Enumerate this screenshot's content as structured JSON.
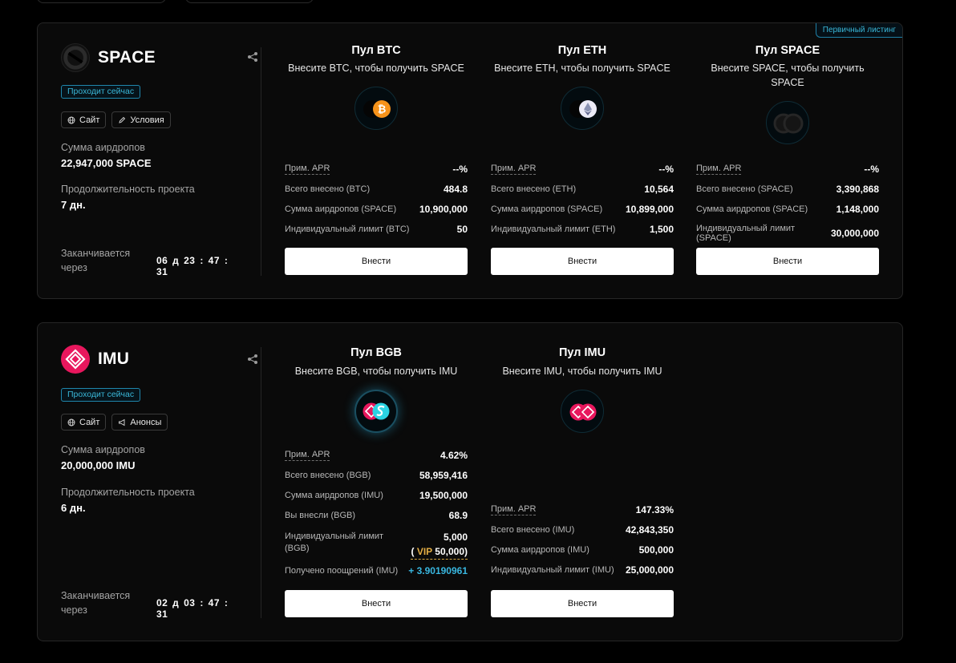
{
  "projects": [
    {
      "name": "SPACE",
      "status": "Проходит сейчас",
      "corner_badge": "Первичный листинг",
      "links": [
        "Сайт",
        "Условия"
      ],
      "airdrop_label": "Сумма аирдропов",
      "airdrop_value": "22,947,000 SPACE",
      "duration_label": "Продолжительность проекта",
      "duration_value": "7 дн.",
      "ends_label": "Заканчивается через",
      "timer": "06 д 23 : 47 : 31",
      "pools": [
        {
          "title": "Пул BTC",
          "subtitle": "Внесите BTC, чтобы получить SPACE",
          "icon": "space-btc-icon",
          "rows": [
            {
              "k": "Прим. APR",
              "v": "--%"
            },
            {
              "k": "Всего внесено (BTC)",
              "v": "484.8"
            },
            {
              "k": "Сумма аирдропов (SPACE)",
              "v": "10,900,000"
            },
            {
              "k": "Индивидуальный лимит (BTC)",
              "v": "50"
            }
          ],
          "button": "Внести"
        },
        {
          "title": "Пул ETH",
          "subtitle": "Внесите ETH, чтобы получить SPACE",
          "icon": "space-eth-icon",
          "rows": [
            {
              "k": "Прим. APR",
              "v": "--%"
            },
            {
              "k": "Всего внесено (ETH)",
              "v": "10,564"
            },
            {
              "k": "Сумма аирдропов (SPACE)",
              "v": "10,899,000"
            },
            {
              "k": "Индивидуальный лимит (ETH)",
              "v": "1,500"
            }
          ],
          "button": "Внести"
        },
        {
          "title": "Пул SPACE",
          "subtitle": "Внесите SPACE, чтобы получить SPACE",
          "icon": "space-space-icon",
          "rows": [
            {
              "k": "Прим. APR",
              "v": "--%"
            },
            {
              "k": "Всего внесено (SPACE)",
              "v": "3,390,868"
            },
            {
              "k": "Сумма аирдропов (SPACE)",
              "v": "1,148,000"
            },
            {
              "k": "Индивидуальный лимит (SPACE)",
              "v": "30,000,000"
            }
          ],
          "button": "Внести"
        }
      ]
    },
    {
      "name": "IMU",
      "status": "Проходит сейчас",
      "links": [
        "Сайт",
        "Анонсы"
      ],
      "airdrop_label": "Сумма аирдропов",
      "airdrop_value": "20,000,000 IMU",
      "duration_label": "Продолжительность проекта",
      "duration_value": "6 дн.",
      "ends_label": "Заканчивается через",
      "timer": "02 д 03 : 47 : 31",
      "pools": [
        {
          "title": "Пул BGB",
          "subtitle": "Внесите BGB, чтобы получить IMU",
          "icon": "imu-bgb-icon",
          "rows": [
            {
              "k": "Прим. APR",
              "v": "4.62%"
            },
            {
              "k": "Всего внесено (BGB)",
              "v": "58,959,416"
            },
            {
              "k": "Сумма аирдропов (IMU)",
              "v": "19,500,000"
            },
            {
              "k": "Вы внесли (BGB)",
              "v": "68.9"
            },
            {
              "k": "Индивидуальный лимит (BGB)",
              "v": "5,000",
              "vip_open": "( ",
              "vip_label": "VIP",
              "vip_value": " 50,000)"
            },
            {
              "k": "Получено поощрений (IMU)",
              "v": "+ 3.90190961"
            }
          ],
          "button": "Внести"
        },
        {
          "title": "Пул IMU",
          "subtitle": "Внесите IMU, чтобы получить IMU",
          "icon": "imu-imu-icon",
          "rows": [
            {
              "k": "Прим. APR",
              "v": "147.33%"
            },
            {
              "k": "Всего внесено (IMU)",
              "v": "42,843,350"
            },
            {
              "k": "Сумма аирдропов (IMU)",
              "v": "500,000"
            },
            {
              "k": "Индивидуальный лимит (IMU)",
              "v": "25,000,000"
            }
          ],
          "button": "Внести"
        }
      ]
    }
  ],
  "colors": {
    "accent": "#3ab7d8",
    "imu_brand": "#e8175d",
    "btc": "#f7931a",
    "vip_gold": "#e2ad44"
  }
}
